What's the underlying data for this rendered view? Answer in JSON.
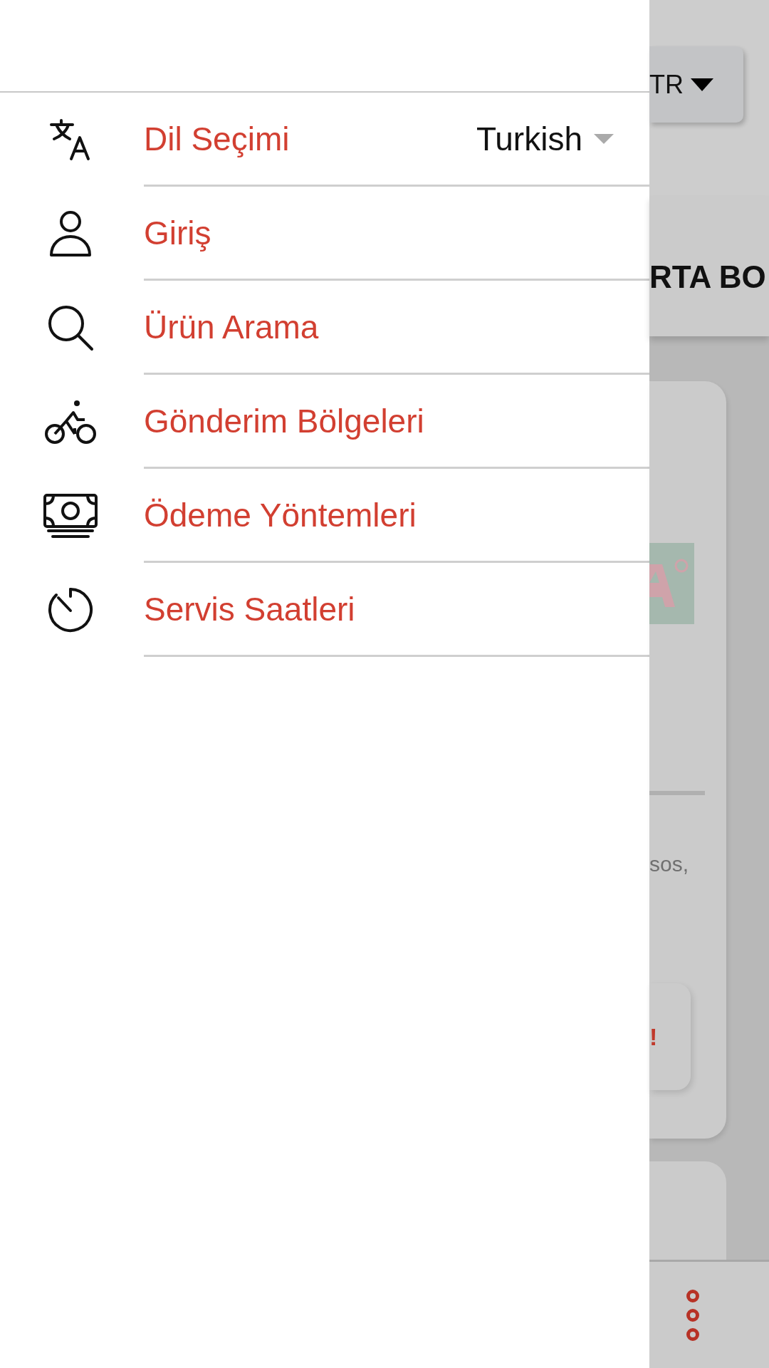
{
  "menu": [
    {
      "label": "Dil Seçimi",
      "value": "Turkish"
    },
    {
      "label": "Giriş"
    },
    {
      "label": "Ürün Arama"
    },
    {
      "label": "Gönderim Bölgeleri"
    },
    {
      "label": "Ödeme Yöntemleri"
    },
    {
      "label": "Servis Saatleri"
    }
  ],
  "background": {
    "language_button": "TR",
    "heading": "RTA BO",
    "text": "sos,",
    "alert": "!"
  }
}
